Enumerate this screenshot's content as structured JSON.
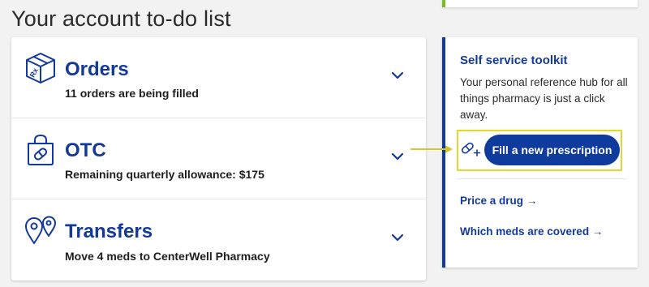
{
  "page": {
    "title": "Your account to-do list"
  },
  "todo": [
    {
      "title": "Orders",
      "subtitle": "11 orders are being filled",
      "icon": "prescription-box-icon"
    },
    {
      "title": "OTC",
      "subtitle": "Remaining quarterly allowance: $175",
      "icon": "shopping-bag-pill-icon"
    },
    {
      "title": "Transfers",
      "subtitle": "Move 4 meds to CenterWell Pharmacy",
      "icon": "location-pins-icon"
    }
  ],
  "toolkit": {
    "title": "Self service toolkit",
    "description": "Your personal reference hub for all things pharmacy is just a click away.",
    "fill_button": "Fill a new prescription",
    "links": [
      "Price a drug →",
      "Which meds are covered →"
    ]
  },
  "colors": {
    "brand_blue": "#13399a",
    "button_blue": "#0f3b9c",
    "highlight_yellow": "#e2d832",
    "accent_green": "#78be20"
  }
}
